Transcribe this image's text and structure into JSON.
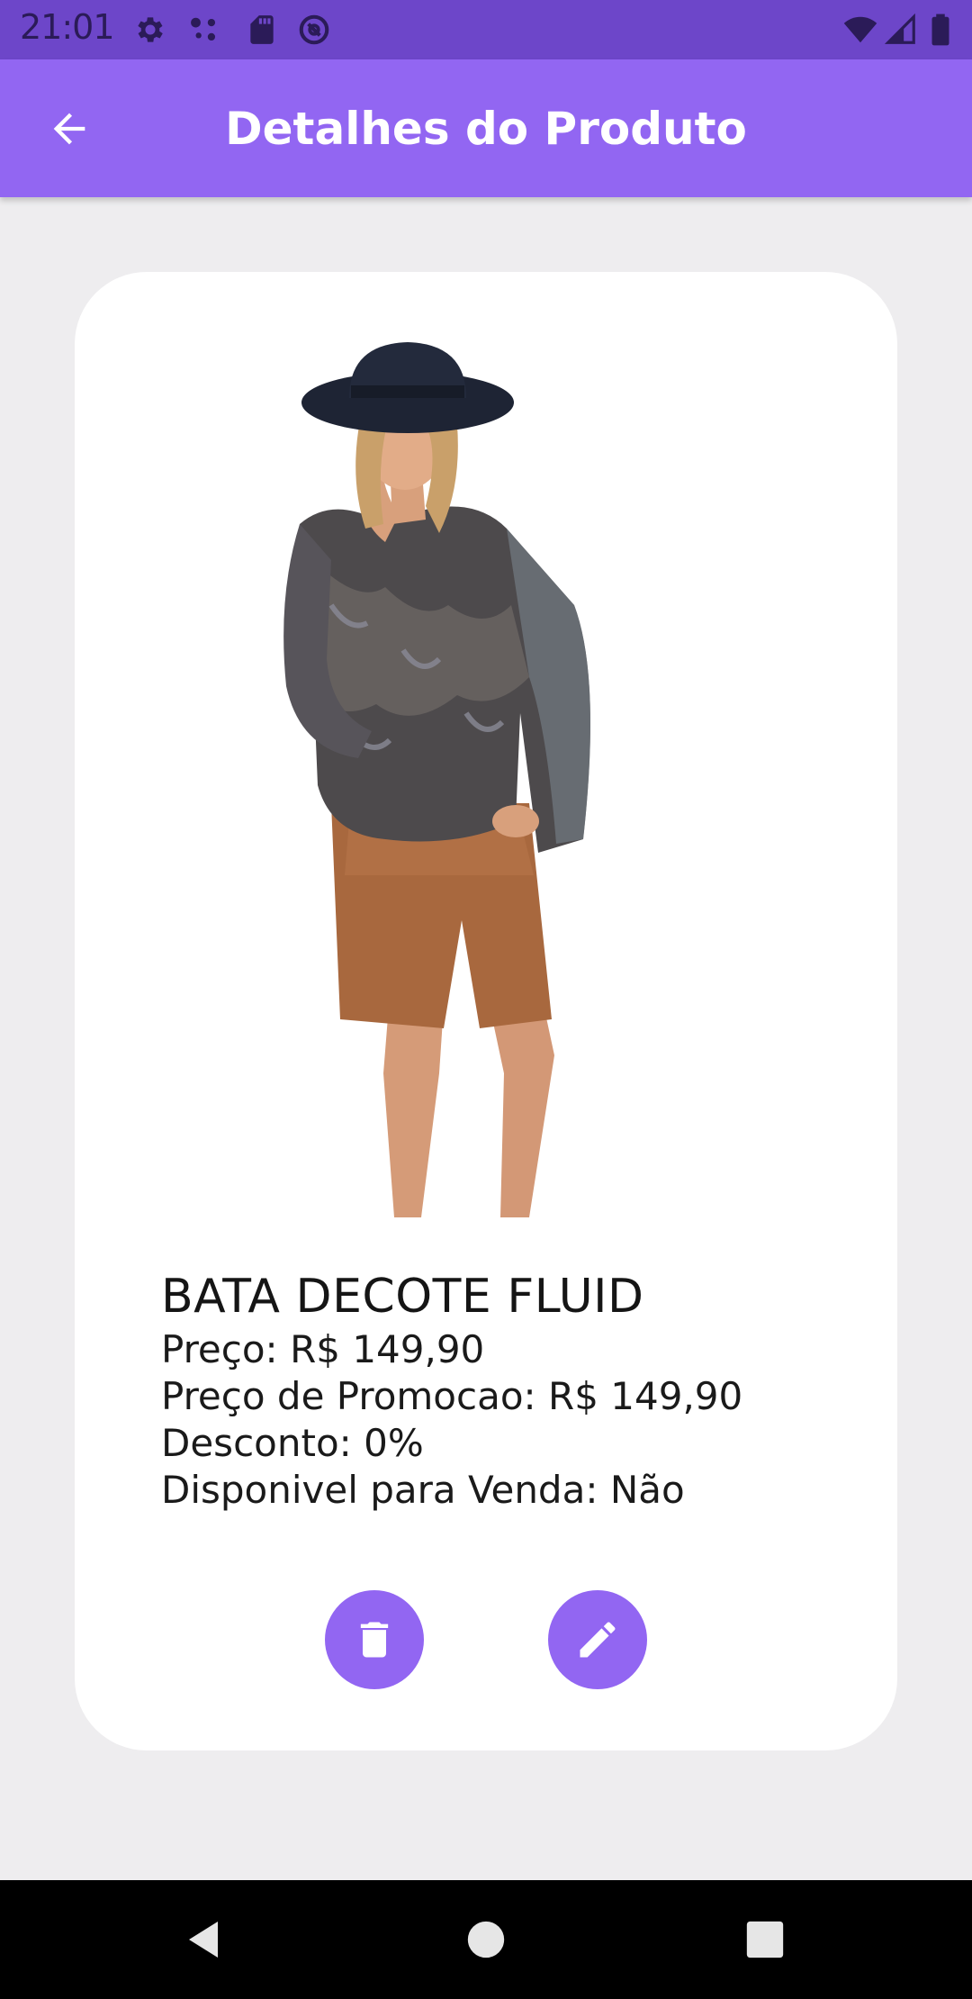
{
  "status_bar": {
    "time": "21:01",
    "left_icons": [
      "gear-icon",
      "hub-icon",
      "sd-card-icon",
      "at-sign-icon"
    ],
    "right_icons": [
      "wifi-icon",
      "signal-icon",
      "battery-icon"
    ]
  },
  "app_bar": {
    "back_icon": "arrow-back-icon",
    "title": "Detalhes do Produto"
  },
  "product": {
    "name": "BATA DECOTE FLUID",
    "price_line": "Preço: R$ 149,90",
    "promo_line": "Preço de Promocao: R$ 149,90",
    "discount_line": "Desconto: 0%",
    "available_line": "Disponivel para Venda: Não"
  },
  "actions": {
    "delete_icon": "trash-icon",
    "edit_icon": "pencil-icon"
  },
  "nav_bar": {
    "buttons": [
      "back-triangle-icon",
      "home-circle-icon",
      "recents-square-icon"
    ]
  },
  "colors": {
    "primary": "#9266f2",
    "status_bar": "#6d46c9",
    "background": "#eeedef",
    "card": "#ffffff"
  }
}
